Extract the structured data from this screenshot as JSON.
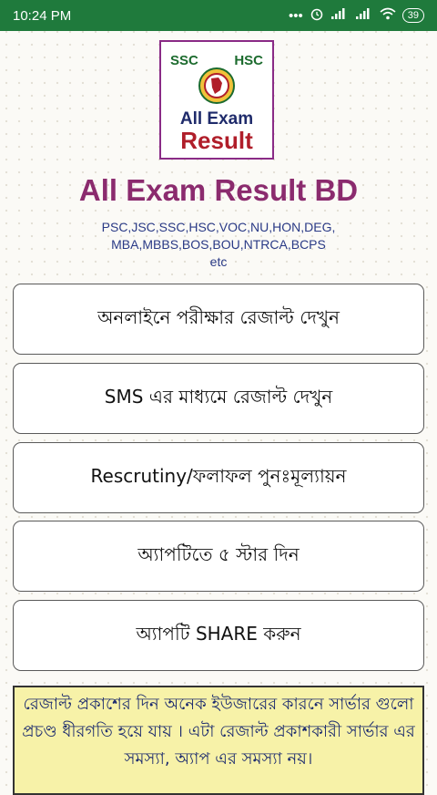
{
  "status_bar": {
    "time": "10:24 PM",
    "icons": [
      "more-dots-icon",
      "alarm-icon",
      "signal-icon",
      "signal-icon",
      "wifi-icon",
      "battery-icon"
    ],
    "battery": "39"
  },
  "logo": {
    "top_left": "SSC",
    "top_right": "HSC",
    "line1": "All Exam",
    "line2": "Result"
  },
  "header": {
    "title": "All Exam Result BD",
    "subtitle_line1": "PSC,JSC,SSC,HSC,VOC,NU,HON,DEG,",
    "subtitle_line2": "MBA,MBBS,BOS,BOU,NTRCA,BCPS",
    "subtitle_line3": "etc"
  },
  "menu": [
    {
      "label": "অনলাইনে পরীক্ষার রেজাল্ট দেখুন"
    },
    {
      "label": "SMS এর মাধ্যমে রেজাল্ট দেখুন"
    },
    {
      "label": "Rescrutiny/ফলাফল পুনঃমূল্যায়ন"
    },
    {
      "label": "অ্যাপটিতে ৫ স্টার দিন"
    },
    {
      "label": "অ্যাপটি SHARE করুন"
    }
  ],
  "notice": {
    "text": "রেজাল্ট প্রকাশের দিন অনেক ইউজারের কারনে সার্ভার গুলো প্রচণ্ড ধীরগতি হয়ে যায় । এটা রেজাল্ট প্রকাশকারী সার্ভার এর সমস্যা, অ্যাপ এর সমস্যা নয়।"
  },
  "colors": {
    "status_bar": "#1f7a3c",
    "title": "#8b2b6e",
    "subtitle": "#2a3a86",
    "notice_bg": "#f7f2a8"
  }
}
